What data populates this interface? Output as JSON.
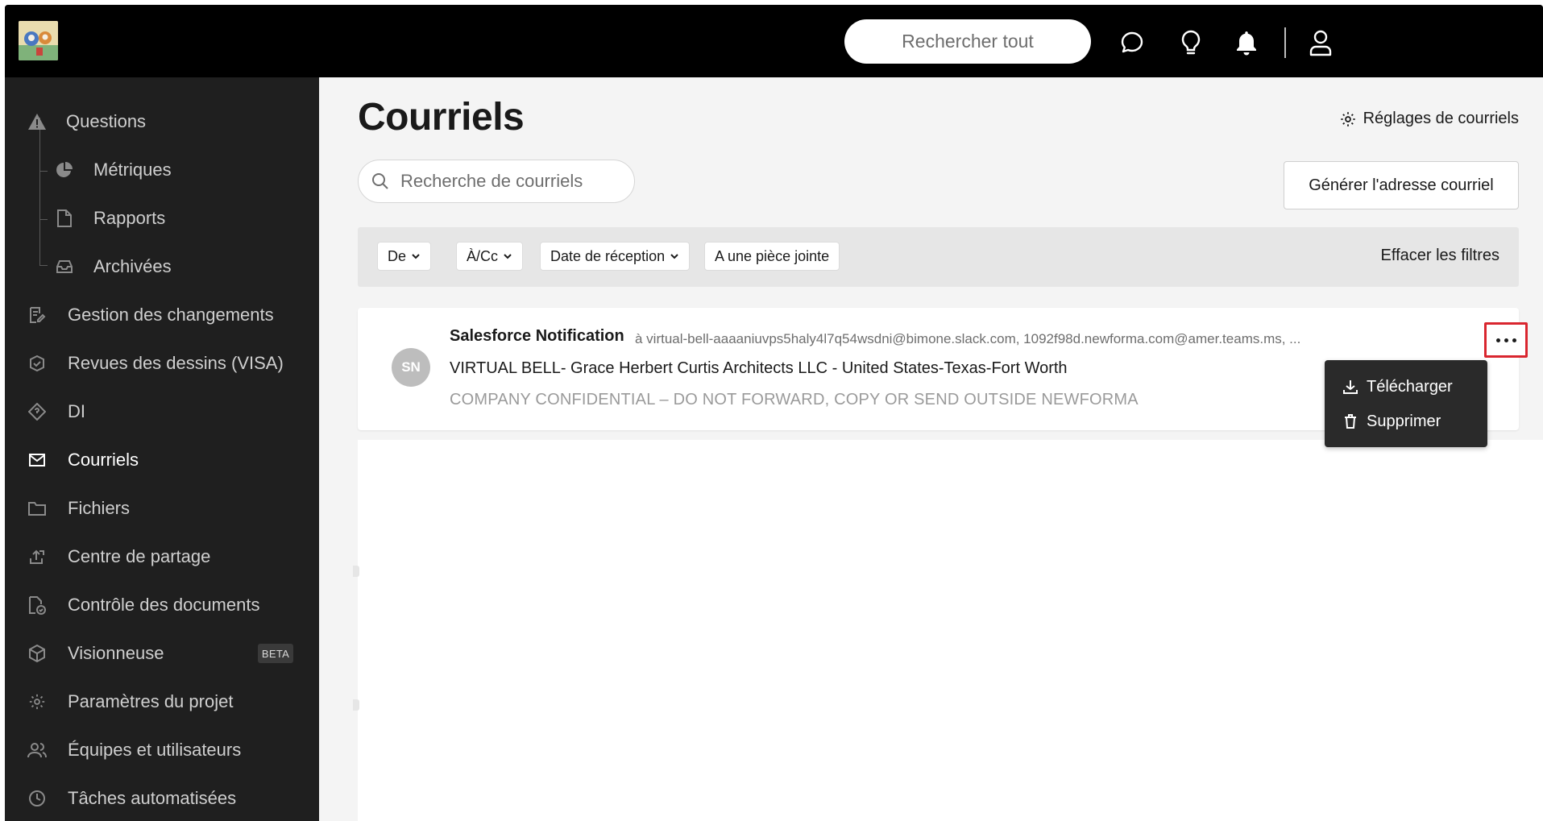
{
  "topbar": {
    "search_placeholder": "Rechercher tout",
    "icons": [
      "chat-icon",
      "lightbulb-icon",
      "bell-icon",
      "user-icon"
    ]
  },
  "sidebar": {
    "items": [
      {
        "label": "Questions",
        "icon": "warning-icon"
      },
      {
        "label": "Métriques",
        "icon": "pie-chart-icon"
      },
      {
        "label": "Rapports",
        "icon": "document-icon"
      },
      {
        "label": "Archivées",
        "icon": "inbox-icon"
      },
      {
        "label": "Gestion des changements",
        "icon": "edit-document-icon"
      },
      {
        "label": "Revues des dessins (VISA)",
        "icon": "check-shield-icon"
      },
      {
        "label": "DI",
        "icon": "diamond-question-icon"
      },
      {
        "label": "Courriels",
        "icon": "mail-icon"
      },
      {
        "label": "Fichiers",
        "icon": "folder-icon"
      },
      {
        "label": "Centre de partage",
        "icon": "share-icon"
      },
      {
        "label": "Contrôle des documents",
        "icon": "document-check-icon"
      },
      {
        "label": "Visionneuse",
        "icon": "cube-icon",
        "badge": "BETA"
      },
      {
        "label": "Paramètres du projet",
        "icon": "gear-icon"
      },
      {
        "label": "Équipes et utilisateurs",
        "icon": "users-icon"
      },
      {
        "label": "Tâches automatisées",
        "icon": "clock-icon"
      }
    ],
    "active": "Courriels"
  },
  "main": {
    "title": "Courriels",
    "settings_link": "Réglages de courriels",
    "search_placeholder": "Recherche de courriels",
    "generate_button": "Générer l'adresse courriel",
    "filters": {
      "from": "De",
      "to_cc": "À/Cc",
      "received_date": "Date de réception",
      "has_attachment": "A une pièce jointe",
      "clear": "Effacer les filtres"
    },
    "emails": [
      {
        "avatar": "SN",
        "sender": "Salesforce Notification",
        "recipients": "à virtual-bell-aaaaniuvps5haly4l7q54wsdni@bimone.slack.com, 1092f98d.newforma.com@amer.teams.ms, ...",
        "subject": "VIRTUAL BELL- Grace Herbert Curtis Architects LLC - United States-Texas-Fort Worth",
        "preview": "COMPANY CONFIDENTIAL – DO NOT FORWARD, COPY OR SEND OUTSIDE NEWFORMA"
      }
    ],
    "context_menu": {
      "download": "Télécharger",
      "delete": "Supprimer"
    }
  },
  "colors": {
    "topbar": "#000000",
    "sidebar": "#1f1f1f",
    "highlight": "#d9262f"
  }
}
